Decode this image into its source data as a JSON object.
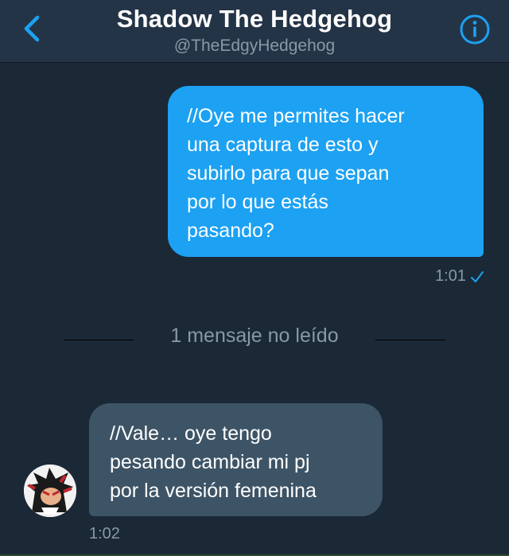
{
  "header": {
    "title": "Shadow The Hedgehog",
    "handle": "@TheEdgyHedgehog",
    "back_icon": "chevron-left-icon",
    "info_icon": "info-circle-icon"
  },
  "messages": [
    {
      "direction": "outgoing",
      "lines": [
        "//Oye me permites hacer",
        "una captura de esto y",
        "subirlo para que sepan",
        "por lo que estás",
        "pasando?"
      ],
      "time": "1:01",
      "status_icon": "check-icon"
    },
    {
      "direction": "incoming",
      "lines": [
        "//Vale… oye tengo",
        "pesando cambiar mi pj",
        "por la versión femenina"
      ],
      "time": "1:02",
      "avatar_icon": "avatar"
    }
  ],
  "unread_divider": "1 mensaje no leído",
  "colors": {
    "background": "#1b2836",
    "header": "#243447",
    "accent": "#1da1f2",
    "incoming_bubble": "#3d5466",
    "muted_text": "#8899a6"
  }
}
